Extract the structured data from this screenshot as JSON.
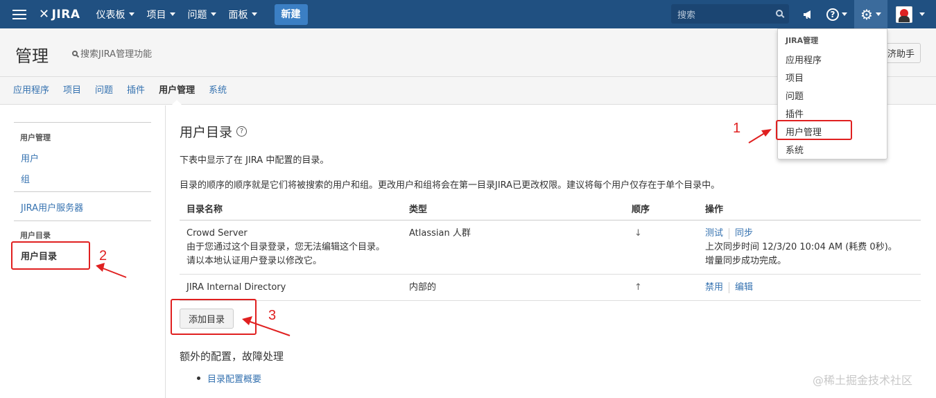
{
  "topnav": {
    "logo": "JIRA",
    "menu": [
      "仪表板",
      "项目",
      "问题",
      "面板"
    ],
    "create_label": "新建",
    "search_placeholder": "搜索"
  },
  "admin_header": {
    "title": "管理",
    "search_label": "搜索JIRA管理功能",
    "helper_label": "济助手"
  },
  "tabs": [
    "应用程序",
    "项目",
    "问题",
    "插件",
    "用户管理",
    "系统"
  ],
  "active_tab": "用户管理",
  "sidebar": {
    "section1_heading": "用户管理",
    "section1_items": [
      "用户",
      "组"
    ],
    "section2_items": [
      "JIRA用户服务器"
    ],
    "section3_heading": "用户目录",
    "active_item": "用户目录"
  },
  "main": {
    "title": "用户目录",
    "description1": "下表中显示了在 JIRA 中配置的目录。",
    "description2": "目录的顺序的顺序就是它们将被搜索的用户和组。更改用户和组将会在第一目录JIRA已更改权限。建议将每个用户仅存在于单个目录中。",
    "columns": [
      "目录名称",
      "类型",
      "顺序",
      "操作"
    ],
    "rows": [
      {
        "name": "Crowd Server",
        "note": "由于您通过这个目录登录，您无法编辑这个目录。请以本地认证用户登录以修改它。",
        "type": "Atlassian 人群",
        "order_arrow": "↓",
        "op1": "测试",
        "op2": "同步",
        "sync_status": "上次同步时间 12/3/20 10:04 AM (耗费 0秒)。",
        "sync_result": "增量同步成功完成。"
      },
      {
        "name": "JIRA Internal Directory",
        "type": "内部的",
        "order_arrow": "↑",
        "op1": "禁用",
        "op2": "编辑"
      }
    ],
    "add_button": "添加目录",
    "extra_heading": "额外的配置，故障处理",
    "extra_link": "目录配置概要"
  },
  "dropdown": {
    "heading": "JIRA管理",
    "items": [
      "应用程序",
      "项目",
      "问题",
      "插件",
      "用户管理",
      "系统"
    ]
  },
  "annotations": [
    "1",
    "2",
    "3"
  ],
  "watermark": "@稀土掘金技术社区",
  "colors": {
    "nav": "#205081",
    "link": "#3572b0",
    "annotation": "#e02020"
  }
}
